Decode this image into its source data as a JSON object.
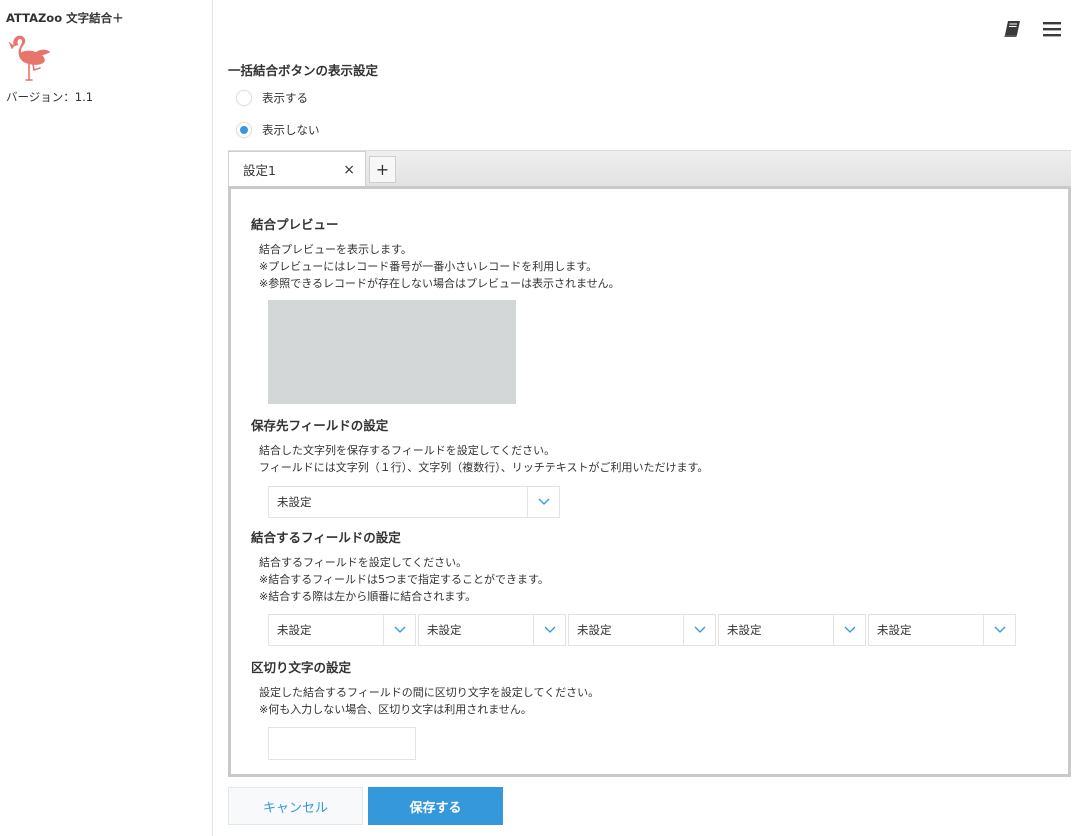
{
  "app": {
    "title": "ATTAZoo 文字結合＋",
    "version": "バージョン：1.1"
  },
  "header": {
    "icons": [
      "manual-book-icon",
      "hamburger-menu-icon"
    ]
  },
  "bulk_button": {
    "title": "一括結合ボタンの表示設定",
    "options": [
      {
        "label": "表示する",
        "checked": false
      },
      {
        "label": "表示しない",
        "checked": true
      }
    ]
  },
  "tabs": {
    "active_label": "設定1",
    "close_symbol": "×",
    "add_symbol": "+"
  },
  "preview": {
    "title": "結合プレビュー",
    "desc": [
      "結合プレビューを表示します。",
      "※プレビューにはレコード番号が一番小さいレコードを利用します。",
      "※参照できるレコードが存在しない場合はプレビューは表示されません。"
    ]
  },
  "destination": {
    "title": "保存先フィールドの設定",
    "desc": [
      "結合した文字列を保存するフィールドを設定してください。",
      "フィールドには文字列（１行）、文字列（複数行）、リッチテキストがご利用いただけます。"
    ],
    "select_value": "未設定"
  },
  "combine": {
    "title": "結合するフィールドの設定",
    "desc": [
      "結合するフィールドを設定してください。",
      "※結合するフィールドは5つまで指定することができます。",
      "※結合する際は左から順番に結合されます。"
    ],
    "selects": [
      "未設定",
      "未設定",
      "未設定",
      "未設定",
      "未設定"
    ]
  },
  "separator": {
    "title": "区切り文字の設定",
    "desc": [
      "設定した結合するフィールドの間に区切り文字を設定してください。",
      "※何も入力しない場合、区切り文字は利用されません。"
    ],
    "value": ""
  },
  "buttons": {
    "cancel": "キャンセル",
    "save": "保存する"
  },
  "colors": {
    "accent": "#3498db",
    "logo": "#e8756b"
  }
}
